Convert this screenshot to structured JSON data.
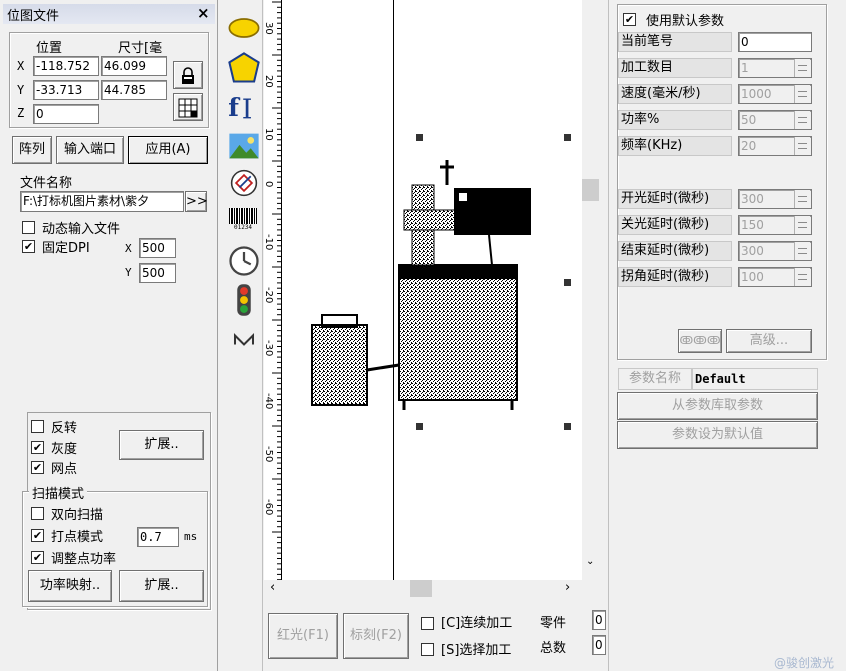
{
  "bitmap_panel": {
    "title": "位图文件",
    "close": "×",
    "pos_header": "位置",
    "size_header": "尺寸[毫",
    "x_label": "X",
    "y_label": "Y",
    "z_label": "Z",
    "x_pos": "-118.752",
    "x_size": "46.099",
    "y_pos": "-33.713",
    "y_size": "44.785",
    "z_pos": "0",
    "array_btn": "阵列",
    "input_port_btn": "输入端口",
    "apply_btn": "应用(A)",
    "filename_label": "文件名称",
    "filename_value": "F:\\打标机图片素材\\紫夕",
    "browse_btn": ">>",
    "dynamic_input_label": "动态输入文件",
    "dynamic_input_checked": false,
    "fixed_dpi_label": "固定DPI",
    "fixed_dpi_checked": true,
    "dpi_x_label": "X",
    "dpi_x": "500",
    "dpi_y_label": "Y",
    "dpi_y": "500",
    "invert_label": "反转",
    "invert_checked": false,
    "gray_label": "灰度",
    "gray_checked": true,
    "dither_label": "网点",
    "dither_checked": true,
    "expand_btn": "扩展..",
    "scan_mode_title": "扫描模式",
    "bidir_label": "双向扫描",
    "bidir_checked": false,
    "dot_mode_label": "打点模式",
    "dot_mode_checked": true,
    "dot_mode_value": "0.7",
    "dot_mode_unit": "ms",
    "adjust_power_label": "调整点功率",
    "adjust_power_checked": true,
    "power_map_btn": "功率映射..",
    "expand2_btn": "扩展.."
  },
  "toolbar": {
    "icons": [
      "ellipse-icon",
      "polygon-icon",
      "text-icon",
      "bitmap-icon",
      "vector-file-icon",
      "barcode-icon",
      "clock-icon",
      "io-light-icon",
      "delay-icon"
    ],
    "barcode_digits": "01234"
  },
  "canvas": {
    "ruler_numbers": [
      "30",
      "20",
      "10",
      "0",
      "-10",
      "-20",
      "-30",
      "-40",
      "-50",
      "-60"
    ]
  },
  "bottom": {
    "red_light_btn": "红光(F1)",
    "mark_btn": "标刻(F2)",
    "continuous_label": "[C]连续加工",
    "continuous_checked": false,
    "select_label": "[S]选择加工",
    "select_checked": false,
    "parts_label": "零件",
    "parts_value": "0",
    "total_label": "总数",
    "total_value": "0"
  },
  "params_panel": {
    "use_default_label": "使用默认参数",
    "use_default_checked": true,
    "rows": [
      {
        "label": "当前笔号",
        "value": "0"
      },
      {
        "label": "加工数目",
        "value": "1"
      },
      {
        "label": "速度(毫米/秒)",
        "value": "1000"
      },
      {
        "label": "功率%",
        "value": "50"
      },
      {
        "label": "频率(KHz)",
        "value": "20"
      },
      {
        "label": "开光延时(微秒)",
        "value": "300"
      },
      {
        "label": "关光延时(微秒)",
        "value": "150"
      },
      {
        "label": "结束延时(微秒)",
        "value": "300"
      },
      {
        "label": "拐角延时(微秒)",
        "value": "100"
      }
    ],
    "advanced_btn": "高级...",
    "param_name_label": "参数名称",
    "param_name_value": "Default",
    "load_from_lib_btn": "从参数库取参数",
    "set_default_btn": "参数设为默认值"
  },
  "watermark": "@骏创激光"
}
